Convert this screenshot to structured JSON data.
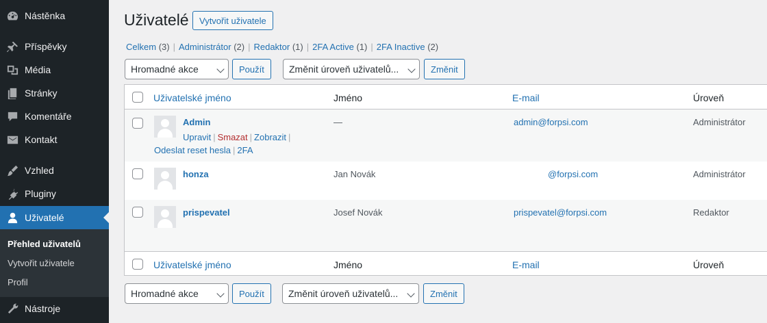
{
  "sidebar": {
    "items": [
      {
        "label": "Nástěnka",
        "icon": "dashboard-icon"
      },
      {
        "label": "Příspěvky",
        "icon": "pin-icon"
      },
      {
        "label": "Média",
        "icon": "media-icon"
      },
      {
        "label": "Stránky",
        "icon": "page-icon"
      },
      {
        "label": "Komentáře",
        "icon": "comment-icon"
      },
      {
        "label": "Kontakt",
        "icon": "mail-icon"
      },
      {
        "label": "Vzhled",
        "icon": "brush-icon"
      },
      {
        "label": "Pluginy",
        "icon": "plugin-icon"
      },
      {
        "label": "Uživatelé",
        "icon": "user-icon"
      },
      {
        "label": "Nástroje",
        "icon": "wrench-icon"
      }
    ],
    "submenu": [
      "Přehled uživatelů",
      "Vytvořit uživatele",
      "Profil"
    ]
  },
  "header": {
    "title": "Uživatelé",
    "add_new": "Vytvořit uživatele"
  },
  "filters": [
    {
      "label": "Celkem",
      "count": "(3)"
    },
    {
      "label": "Administrátor",
      "count": "(2)"
    },
    {
      "label": "Redaktor",
      "count": "(1)"
    },
    {
      "label": "2FA Active",
      "count": "(1)"
    },
    {
      "label": "2FA Inactive",
      "count": "(2)"
    }
  ],
  "tablenav": {
    "bulk_select": "Hromadné akce",
    "apply": "Použít",
    "role_select": "Změnit úroveň uživatelů...",
    "change": "Změnit"
  },
  "columns": {
    "username": "Uživatelské jméno",
    "name": "Jméno",
    "email": "E-mail",
    "role": "Úroveň"
  },
  "row_actions": [
    "Upravit",
    "Smazat",
    "Zobrazit",
    "Odeslat reset hesla",
    "2FA"
  ],
  "users": [
    {
      "username": "Admin",
      "name": "—",
      "email": "admin@forpsi.com",
      "role": "Administrátor"
    },
    {
      "username": "honza",
      "name": "Jan Novák",
      "email": "@forpsi.com",
      "role": "Administrátor"
    },
    {
      "username": "prispevatel",
      "name": "Josef Novák",
      "email": "prispevatel@forpsi.com",
      "role": "Redaktor"
    }
  ],
  "colors": {
    "sidebar_bg": "#1d2327",
    "accent": "#2271b1",
    "danger": "#b32d2e",
    "page_bg": "#f0f0f1"
  }
}
